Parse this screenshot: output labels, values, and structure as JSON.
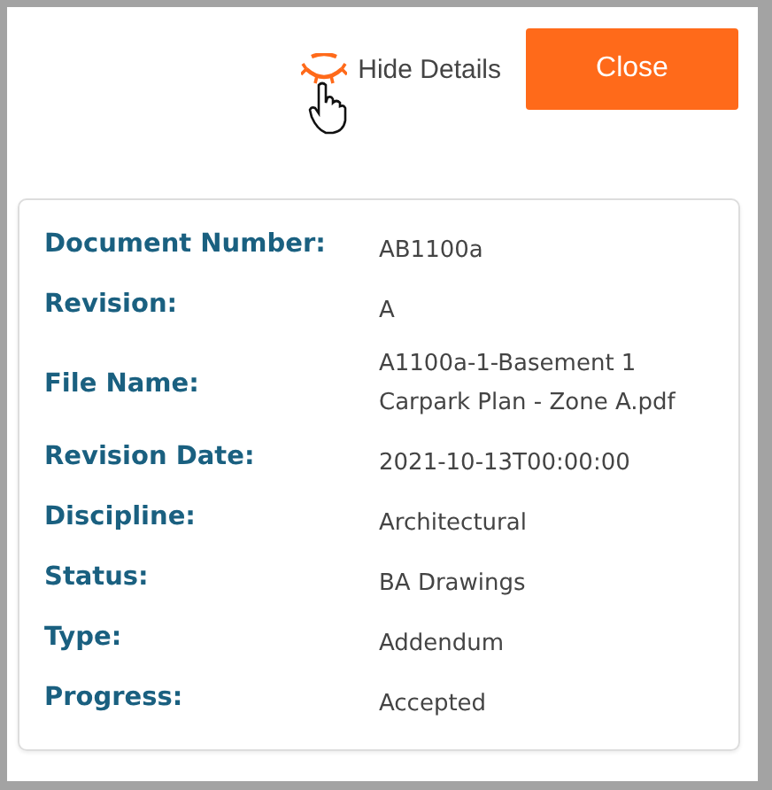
{
  "header": {
    "toggle": {
      "label": "Hide Details",
      "expanded": true
    },
    "close_button": "Close"
  },
  "details": [
    {
      "label": "Document Number:",
      "value": "AB1100a"
    },
    {
      "label": "Revision:",
      "value": "A"
    },
    {
      "label": "File Name:",
      "value": "A1100a-1-Basement 1 Carpark Plan - Zone A.pdf"
    },
    {
      "label": "Revision Date:",
      "value": "2021-10-13T00:00:00"
    },
    {
      "label": "Discipline:",
      "value": "Architectural"
    },
    {
      "label": "Status:",
      "value": "BA Drawings"
    },
    {
      "label": "Type:",
      "value": "Addendum"
    },
    {
      "label": "Progress:",
      "value": "Accepted"
    }
  ]
}
